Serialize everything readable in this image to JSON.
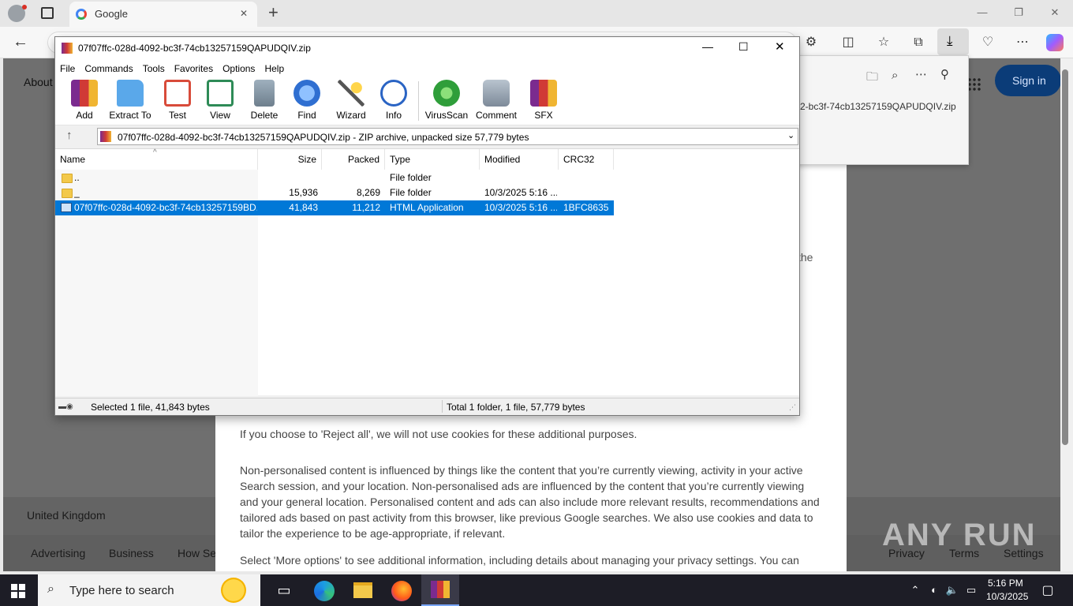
{
  "browser": {
    "tab_title": "Google",
    "tab_close": "✕",
    "new_tab": "+",
    "back": "←",
    "minimize": "—",
    "restore": "❐",
    "close": "✕"
  },
  "google_page": {
    "about": "About",
    "sign_in": "Sign in",
    "fragment_the": "the",
    "para_reject": "If you choose to 'Reject all', we will not use cookies for these additional purposes.",
    "para_nonpersonalised": "Non-personalised content is influenced by things like the content that you’re currently viewing, activity in your active Search session, and your location. Non-personalised ads are influenced by the content that you’re currently viewing and your general location. Personalised content and ads can also include more relevant results, recommendations and tailored ads based on past activity from this browser, like previous Google searches. We also use cookies and data to tailor the experience to be age-appropriate, if relevant.",
    "para_more_options": "Select 'More options' to see additional information, including details about managing your privacy settings. You can",
    "country": "United Kingdom",
    "footer_links": [
      "Advertising",
      "Business",
      "How Se"
    ],
    "footer_right": [
      "Privacy",
      "Terms",
      "Settings"
    ],
    "watermark": "ANY RUN"
  },
  "downloads": {
    "filename_fragment": "2-bc3f-74cb13257159QAPUDQIV.zip"
  },
  "winrar": {
    "title": "07f07ffc-028d-4092-bc3f-74cb13257159QAPUDQIV.zip",
    "menu": [
      "File",
      "Commands",
      "Tools",
      "Favorites",
      "Options",
      "Help"
    ],
    "toolbar": [
      {
        "label": "Add",
        "icon": "add-archive-icon",
        "color": "#c0392b"
      },
      {
        "label": "Extract To",
        "icon": "extract-folder-icon",
        "color": "#3b8fd9"
      },
      {
        "label": "Test",
        "icon": "test-clipboard-icon",
        "color": "#d84b3a"
      },
      {
        "label": "View",
        "icon": "view-book-icon",
        "color": "#2e8b57"
      },
      {
        "label": "Delete",
        "icon": "delete-bin-icon",
        "color": "#8a9aa8"
      },
      {
        "label": "Find",
        "icon": "find-magnifier-icon",
        "color": "#2f6fd1"
      },
      {
        "label": "Wizard",
        "icon": "wizard-wand-icon",
        "color": "#6fb24a"
      },
      {
        "label": "Info",
        "icon": "info-icon",
        "color": "#2a64c4"
      },
      {
        "label": "VirusScan",
        "icon": "virus-scan-icon",
        "color": "#2f9e3a"
      },
      {
        "label": "Comment",
        "icon": "comment-icon",
        "color": "#7d8a99"
      },
      {
        "label": "SFX",
        "icon": "sfx-box-icon",
        "color": "#e59a2d"
      }
    ],
    "path_text": "07f07ffc-028d-4092-bc3f-74cb13257159QAPUDQIV.zip - ZIP archive, unpacked size 57,779 bytes",
    "columns": [
      "Name",
      "Size",
      "Packed",
      "Type",
      "Modified",
      "CRC32"
    ],
    "rows": [
      {
        "name": "..",
        "size": "",
        "packed": "",
        "type": "File folder",
        "modified": "",
        "crc": ""
      },
      {
        "name": "_",
        "size": "15,936",
        "packed": "8,269",
        "type": "File folder",
        "modified": "10/3/2025 5:16 ...",
        "crc": ""
      },
      {
        "name": "07f07ffc-028d-4092-bc3f-74cb13257159BD...",
        "size": "41,843",
        "packed": "11,212",
        "type": "HTML Application",
        "modified": "10/3/2025 5:16 ...",
        "crc": "1BFC8635"
      }
    ],
    "status_left": "Selected 1 file, 41,843 bytes",
    "status_right": "Total 1 folder, 1 file, 57,779 bytes"
  },
  "taskbar": {
    "search_placeholder": "Type here to search",
    "time": "5:16 PM",
    "date": "10/3/2025"
  }
}
